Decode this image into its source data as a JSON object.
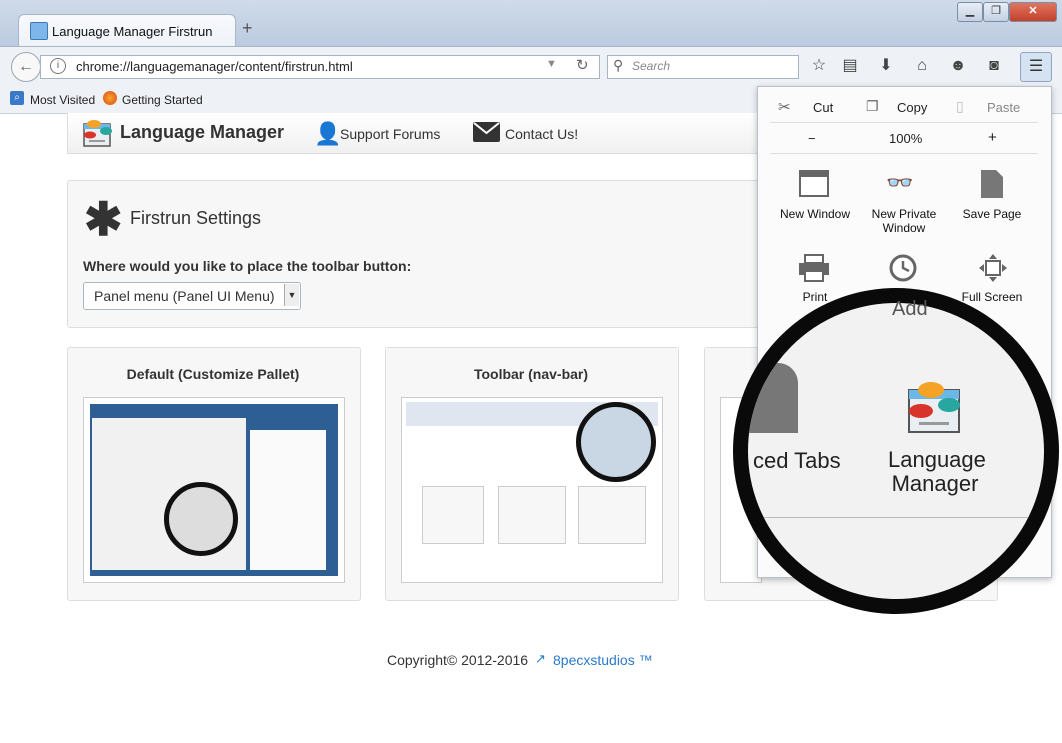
{
  "window": {
    "tab_title": "Language Manager Firstrun",
    "new_tab": "+",
    "min": "▁",
    "max": "❐",
    "close": "✕"
  },
  "navbar": {
    "url": "chrome://languagemanager/content/firstrun.html",
    "search_placeholder": "Search"
  },
  "bookmarks": {
    "most_visited": "Most Visited",
    "getting_started": "Getting Started"
  },
  "header": {
    "brand": "Language Manager",
    "support": "Support Forums",
    "contact": "Contact Us!"
  },
  "settings": {
    "title": "Firstrun Settings",
    "question": "Where would you like to place the toolbar button:",
    "select_value": "Panel menu (Panel UI Menu)"
  },
  "cards": [
    {
      "title": "Default (Customize Pallet)"
    },
    {
      "title": "Toolbar (nav-bar)"
    },
    {
      "title": ""
    }
  ],
  "footer": {
    "copyright": "Copyright© 2012-2016",
    "link": "8pecxstudios ™"
  },
  "panel_menu": {
    "cut": "Cut",
    "copy": "Copy",
    "paste": "Paste",
    "zoom_out": "−",
    "zoom": "100%",
    "zoom_in": "+",
    "items": [
      {
        "label": "New Window",
        "icon": "window-icon"
      },
      {
        "label": "New Private Window",
        "icon": "mask-icon"
      },
      {
        "label": "Save Page",
        "icon": "page-icon"
      },
      {
        "label": "Print",
        "icon": "printer-icon"
      },
      {
        "label": "",
        "icon": "clock-icon"
      },
      {
        "label": "Full Screen",
        "icon": "fullscreen-icon"
      }
    ]
  },
  "magnifier": {
    "partial_left": "ced Tabs",
    "partial_top": "Add",
    "label": "Language Manager"
  }
}
